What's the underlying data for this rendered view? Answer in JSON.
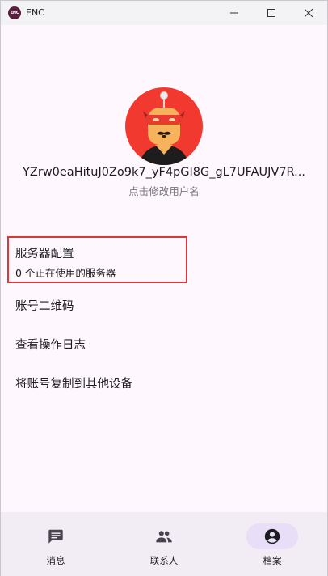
{
  "window": {
    "title": "ENC",
    "logo_text": "ENC"
  },
  "profile": {
    "username": "YZrw0eaHituJ0Zo9k7_yF4pGI8G_gL7UFAUJV7R...",
    "hint": "点击修改用户名",
    "avatar_colors": {
      "background": "#f1392f",
      "face": "#f6b35c",
      "mask": "#e83a2f"
    }
  },
  "menu": {
    "items": [
      {
        "title": "服务器配置",
        "subtitle": "0 个正在使用的服务器"
      },
      {
        "title": "账号二维码"
      },
      {
        "title": "查看操作日志"
      },
      {
        "title": "将账号复制到其他设备"
      }
    ]
  },
  "nav": {
    "items": [
      {
        "label": "消息",
        "icon": "chat-icon",
        "active": false
      },
      {
        "label": "联系人",
        "icon": "people-icon",
        "active": false
      },
      {
        "label": "档案",
        "icon": "account-circle-icon",
        "active": true
      }
    ]
  },
  "colors": {
    "highlight": "#d9383a",
    "nav_active": "#e8def8",
    "background": "#fef7fd"
  }
}
